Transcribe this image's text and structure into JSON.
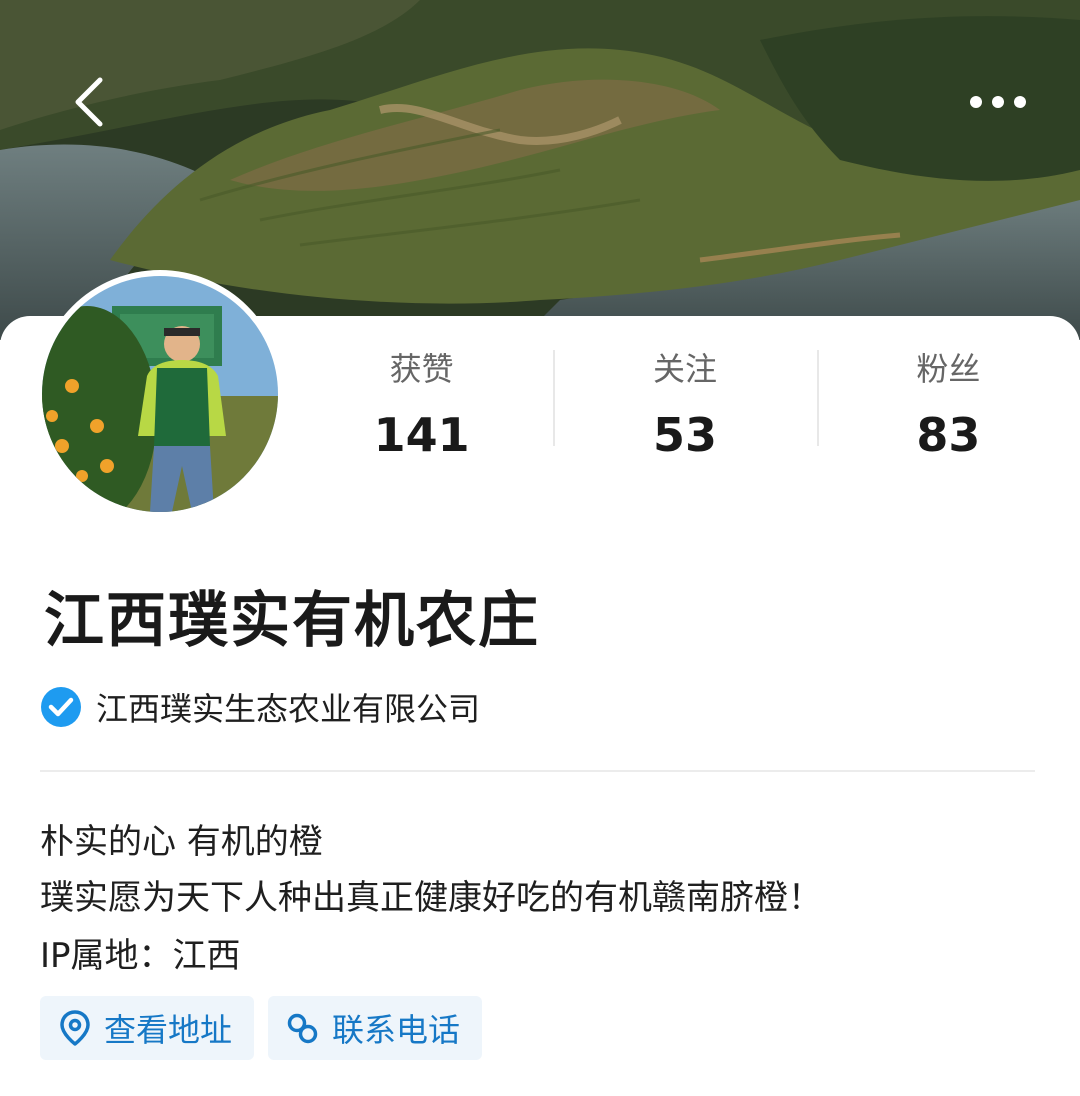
{
  "header": {
    "back_icon": "chevron-left-icon",
    "more_icon": "more-dots-icon"
  },
  "profile": {
    "name": "江西璞实有机农庄",
    "verified_org": "江西璞实生态农业有限公司",
    "verified_icon": "verified-check-icon"
  },
  "stats": [
    {
      "label": "获赞",
      "value": "141"
    },
    {
      "label": "关注",
      "value": "53"
    },
    {
      "label": "粉丝",
      "value": "83"
    }
  ],
  "bio": {
    "line1": "朴实的心 有机的橙",
    "line2": "璞实愿为天下人种出真正健康好吃的有机赣南脐橙！",
    "ip": "IP属地：江西"
  },
  "actions": {
    "address_label": "查看地址",
    "address_icon": "location-pin-icon",
    "phone_label": "联系电话",
    "phone_icon": "phone-link-icon"
  },
  "colors": {
    "accent": "#1678c6",
    "verified_blue": "#1e9bf0",
    "chip_bg": "#eef5fb"
  }
}
